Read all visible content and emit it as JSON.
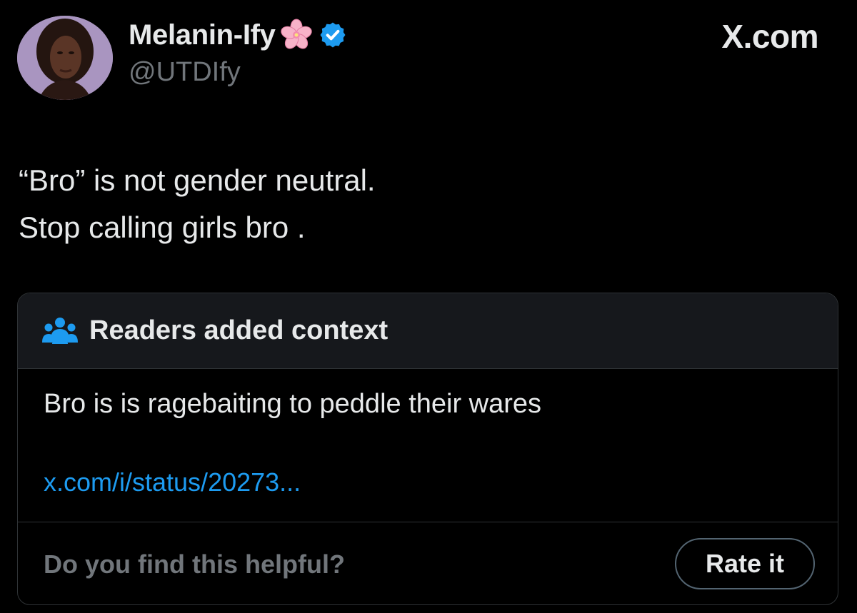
{
  "author": {
    "display_name": "Melanin-Ify",
    "handle": "@UTDIfy",
    "name_emoji": "cherry-blossom-icon",
    "verified": true,
    "verified_color": "#1d9bf0"
  },
  "brand": {
    "label": "X.com"
  },
  "tweet": {
    "lines": [
      "“Bro” is not gender neutral.",
      "Stop calling girls bro ."
    ]
  },
  "community_note": {
    "icon": "readers-icon",
    "title": "Readers added context",
    "body": "Bro is is ragebaiting to peddle their wares",
    "link": "x.com/i/status/20273...",
    "helpful_question": "Do you find this helpful?",
    "rate_button_label": "Rate it"
  },
  "colors": {
    "background": "#000000",
    "text_primary": "#e7e9ea",
    "text_secondary": "#71767b",
    "accent": "#1d9bf0",
    "note_header_bg": "#16181c",
    "border": "#2f3336"
  }
}
